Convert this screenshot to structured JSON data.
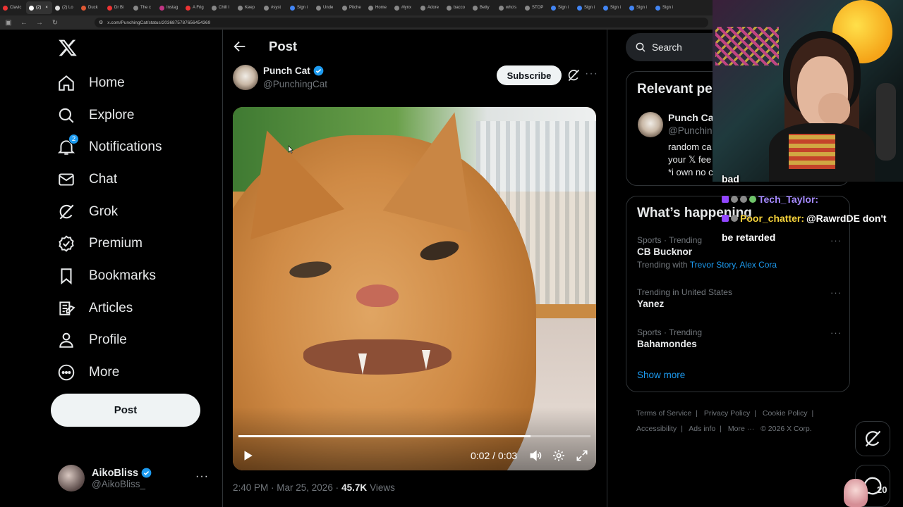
{
  "browser": {
    "tabs": [
      {
        "label": "Clavic",
        "color": "#e33"
      },
      {
        "label": "(2) ",
        "color": "#fff",
        "active": true
      },
      {
        "label": "(2) Lo",
        "color": "#ddd"
      },
      {
        "label": "Duck",
        "color": "#de5833"
      },
      {
        "label": "Dr Bi",
        "color": "#e33"
      },
      {
        "label": "The c",
        "color": "#888"
      },
      {
        "label": "Instag",
        "color": "#c13584"
      },
      {
        "label": "A Frig",
        "color": "#e33"
      },
      {
        "label": "Chill I",
        "color": "#888"
      },
      {
        "label": "Keep",
        "color": "#888"
      },
      {
        "label": "#syst",
        "color": "#888"
      },
      {
        "label": "Sign i",
        "color": "#4285f4"
      },
      {
        "label": "Unde",
        "color": "#888"
      },
      {
        "label": "Pitche",
        "color": "#888"
      },
      {
        "label": "Home",
        "color": "#888"
      },
      {
        "label": "#lynx",
        "color": "#888"
      },
      {
        "label": "Adore",
        "color": "#888"
      },
      {
        "label": "bacco",
        "color": "#888"
      },
      {
        "label": "Betty",
        "color": "#888"
      },
      {
        "label": "who's",
        "color": "#888"
      },
      {
        "label": "STOP",
        "color": "#888"
      },
      {
        "label": "Sign i",
        "color": "#4285f4"
      },
      {
        "label": "Sign i",
        "color": "#4285f4"
      },
      {
        "label": "Sign i",
        "color": "#4285f4"
      },
      {
        "label": "Sign i",
        "color": "#4285f4"
      },
      {
        "label": "Sign i",
        "color": "#4285f4"
      }
    ],
    "url": "x.com/PunchingCat/status/2036875787656454369"
  },
  "nav": {
    "items": [
      {
        "label": "Home",
        "icon": "home-icon"
      },
      {
        "label": "Explore",
        "icon": "search-icon"
      },
      {
        "label": "Notifications",
        "icon": "bell-icon",
        "badge": "2"
      },
      {
        "label": "Chat",
        "icon": "mail-icon"
      },
      {
        "label": "Grok",
        "icon": "grok-icon"
      },
      {
        "label": "Premium",
        "icon": "verified-icon"
      },
      {
        "label": "Bookmarks",
        "icon": "bookmark-icon"
      },
      {
        "label": "Articles",
        "icon": "article-icon"
      },
      {
        "label": "Profile",
        "icon": "person-icon"
      },
      {
        "label": "More",
        "icon": "more-circle-icon"
      }
    ],
    "post_button": "Post"
  },
  "account": {
    "name": "AikoBliss",
    "handle": "@AikoBliss_"
  },
  "post": {
    "header_title": "Post",
    "author_name": "Punch Cat",
    "author_handle": "@PunchingCat",
    "subscribe_label": "Subscribe",
    "video": {
      "time": "0:02 / 0:03",
      "progress": 0.83
    },
    "timestamp": "2:40 PM · Mar 25, 2026 ·",
    "views_count": "45.7K",
    "views_label": "Views"
  },
  "sidebar": {
    "search_placeholder": "Search",
    "relevant_title": "Relevant pe",
    "relevant": {
      "name": "Punch Ca",
      "handle": "@Punchin",
      "bio": [
        "random ca",
        "your 𝕏 fee",
        "*i own no c"
      ]
    },
    "happening_title": "What’s happening",
    "trends": [
      {
        "category": "Sports · Trending",
        "name": "CB Bucknor",
        "with_label": "Trending with",
        "with_links": "Trevor Story, Alex Cora"
      },
      {
        "category": "Trending in United States",
        "name": "Yanez"
      },
      {
        "category": "Sports · Trending",
        "name": "Bahamondes"
      }
    ],
    "show_more": "Show more",
    "footer": [
      "Terms of Service",
      "|",
      "Privacy Policy",
      "|",
      "Cookie Policy",
      "|",
      "Accessibility",
      "|",
      "Ads info",
      "|",
      "More ···",
      "© 2026 X Corp."
    ]
  },
  "stream": {
    "chat": [
      {
        "text": "bad"
      },
      {
        "user": "Tech_Taylor:",
        "text": ""
      },
      {
        "user": "Poor_chatter:",
        "text": "@RawrdDE don't"
      },
      {
        "text": "be retarded"
      }
    ],
    "count": "20"
  },
  "colors": {
    "accent": "#1d9bf0",
    "background": "#000000",
    "text": "#e7e9ea",
    "muted": "#71767b"
  }
}
